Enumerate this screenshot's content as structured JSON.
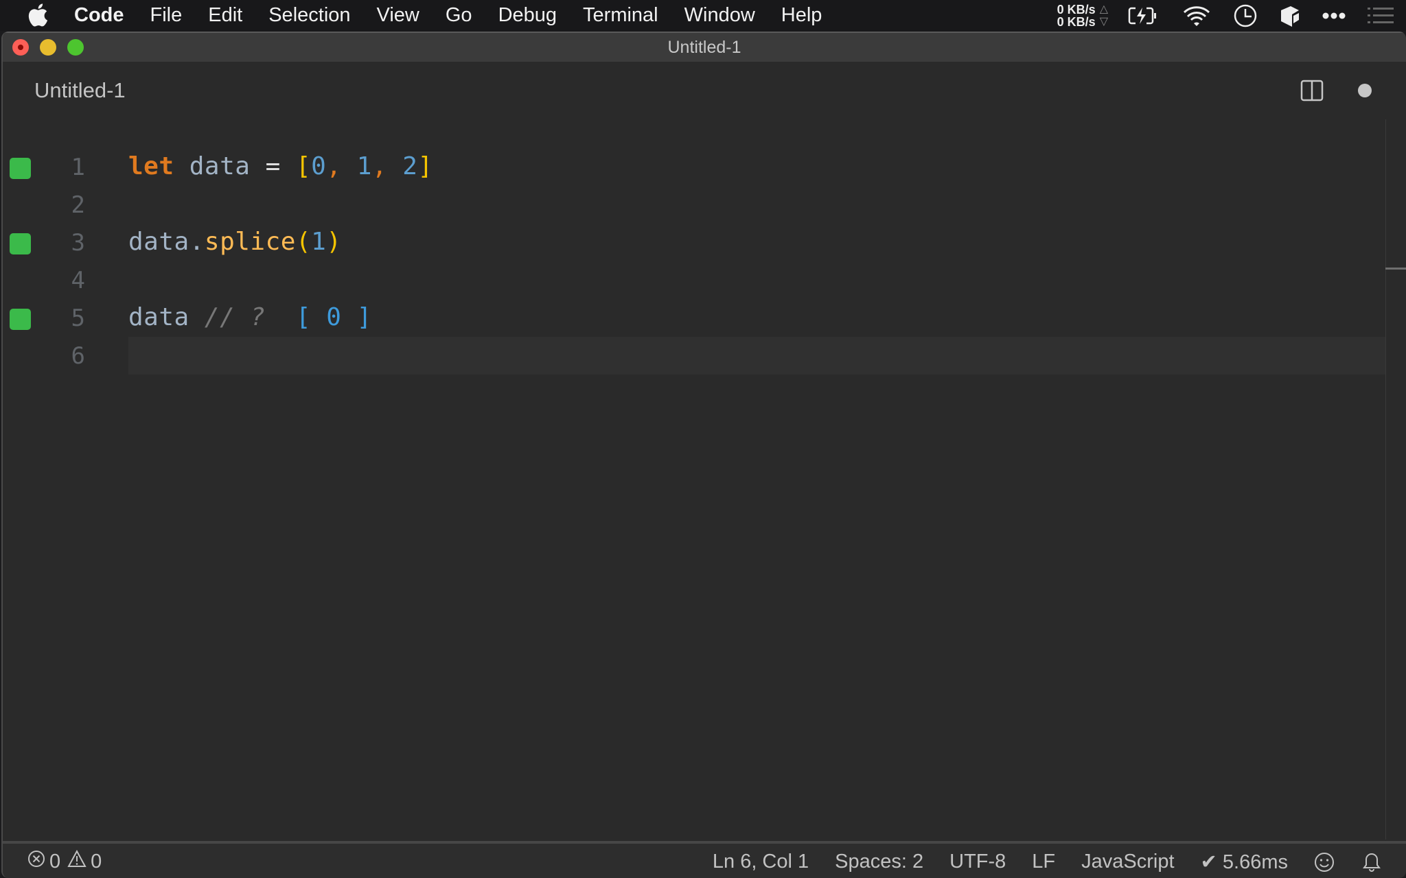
{
  "menubar": {
    "app_name": "Code",
    "items": [
      "File",
      "Edit",
      "Selection",
      "View",
      "Go",
      "Debug",
      "Terminal",
      "Window",
      "Help"
    ],
    "net_up": "0 KB/s",
    "net_down": "0 KB/s",
    "net_up_arrow": "△",
    "net_down_arrow": "▽",
    "tray_icons": [
      "battery-charging-icon",
      "wifi-icon",
      "clock-icon",
      "box-app-icon",
      "more-icon",
      "list-icon"
    ]
  },
  "window": {
    "title": "Untitled-1"
  },
  "tab": {
    "title": "Untitled-1",
    "dirty": true
  },
  "editor": {
    "lines": [
      {
        "number": "1",
        "marker": true,
        "tokens": [
          {
            "t": "let",
            "c": "kw"
          },
          {
            "t": " ",
            "c": ""
          },
          {
            "t": "data",
            "c": "var"
          },
          {
            "t": " = ",
            "c": "op"
          },
          {
            "t": "[",
            "c": "brk"
          },
          {
            "t": "0",
            "c": "num"
          },
          {
            "t": ",",
            "c": "comma"
          },
          {
            "t": " ",
            "c": ""
          },
          {
            "t": "1",
            "c": "num"
          },
          {
            "t": ",",
            "c": "comma"
          },
          {
            "t": " ",
            "c": ""
          },
          {
            "t": "2",
            "c": "num"
          },
          {
            "t": "]",
            "c": "brk"
          }
        ]
      },
      {
        "number": "2",
        "marker": false,
        "tokens": []
      },
      {
        "number": "3",
        "marker": true,
        "tokens": [
          {
            "t": "data",
            "c": "var"
          },
          {
            "t": ".",
            "c": "var"
          },
          {
            "t": "splice",
            "c": "fn"
          },
          {
            "t": "(",
            "c": "brk"
          },
          {
            "t": "1",
            "c": "num"
          },
          {
            "t": ")",
            "c": "brk"
          }
        ]
      },
      {
        "number": "4",
        "marker": false,
        "tokens": []
      },
      {
        "number": "5",
        "marker": true,
        "tokens": [
          {
            "t": "data",
            "c": "var"
          },
          {
            "t": " ",
            "c": ""
          },
          {
            "t": "// ?",
            "c": "cmt"
          },
          {
            "t": "  ",
            "c": ""
          },
          {
            "t": "[ 0 ]",
            "c": "res"
          }
        ]
      },
      {
        "number": "6",
        "marker": false,
        "current": true,
        "tokens": []
      }
    ],
    "marker_color": "#3bba4a"
  },
  "statusbar": {
    "errors": "0",
    "warnings": "0",
    "position": "Ln 6, Col 1",
    "indent": "Spaces: 2",
    "encoding": "UTF-8",
    "eol": "LF",
    "language": "JavaScript",
    "timing": "✔ 5.66ms"
  }
}
